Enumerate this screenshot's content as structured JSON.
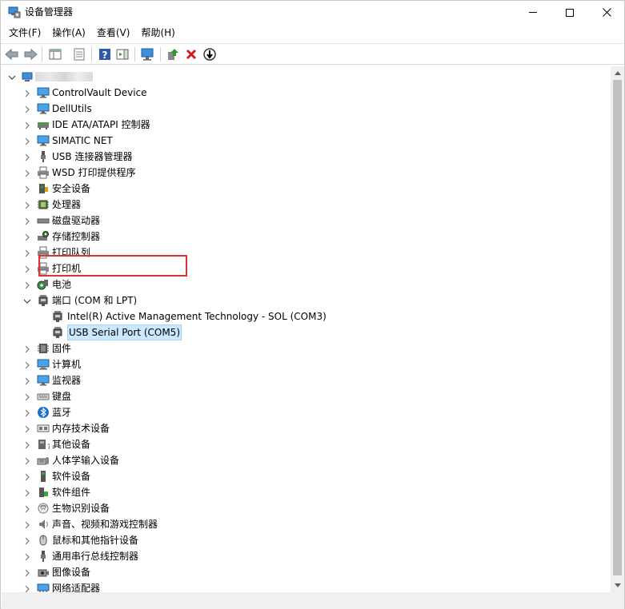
{
  "window": {
    "title": "设备管理器"
  },
  "menu": [
    "文件(F)",
    "操作(A)",
    "查看(V)",
    "帮助(H)"
  ],
  "toolbar": {
    "buttons": [
      "back-icon",
      "forward-icon",
      "show-hide-console-tree-icon",
      "properties-icon",
      "help-icon",
      "action-pane-icon",
      "scan-hardware-icon",
      "update-driver-icon",
      "uninstall-icon",
      "disable-icon"
    ]
  },
  "tree": {
    "root": {
      "label": "",
      "blurred": true
    },
    "items": [
      {
        "label": "ControlVault Device",
        "icon": "monitor-icon",
        "level": 1,
        "expanded": false
      },
      {
        "label": "DellUtils",
        "icon": "monitor-icon",
        "level": 1,
        "expanded": false
      },
      {
        "label": "IDE ATA/ATAPI 控制器",
        "icon": "ide-controller-icon",
        "level": 1,
        "expanded": false
      },
      {
        "label": "SIMATIC NET",
        "icon": "monitor-icon",
        "level": 1,
        "expanded": false
      },
      {
        "label": "USB 连接器管理器",
        "icon": "usb-icon",
        "level": 1,
        "expanded": false
      },
      {
        "label": "WSD 打印提供程序",
        "icon": "printer-icon",
        "level": 1,
        "expanded": false
      },
      {
        "label": "安全设备",
        "icon": "security-icon",
        "level": 1,
        "expanded": false
      },
      {
        "label": "处理器",
        "icon": "processor-icon",
        "level": 1,
        "expanded": false
      },
      {
        "label": "磁盘驱动器",
        "icon": "disk-drive-icon",
        "level": 1,
        "expanded": false
      },
      {
        "label": "存储控制器",
        "icon": "storage-controller-icon",
        "level": 1,
        "expanded": false
      },
      {
        "label": "打印队列",
        "icon": "printer-icon",
        "level": 1,
        "expanded": false
      },
      {
        "label": "打印机",
        "icon": "printer-icon",
        "level": 1,
        "expanded": false
      },
      {
        "label": "电池",
        "icon": "battery-icon",
        "level": 1,
        "expanded": false
      },
      {
        "label": "端口 (COM 和 LPT)",
        "icon": "port-icon",
        "level": 1,
        "expanded": true
      },
      {
        "label": "Intel(R) Active Management Technology - SOL (COM3)",
        "icon": "port-icon",
        "level": 2
      },
      {
        "label": "USB Serial Port (COM5)",
        "icon": "port-icon",
        "level": 2,
        "selected": true
      },
      {
        "label": "固件",
        "icon": "firmware-icon",
        "level": 1,
        "expanded": false
      },
      {
        "label": "计算机",
        "icon": "computer-icon",
        "level": 1,
        "expanded": false
      },
      {
        "label": "监视器",
        "icon": "monitor-icon",
        "level": 1,
        "expanded": false
      },
      {
        "label": "键盘",
        "icon": "keyboard-icon",
        "level": 1,
        "expanded": false
      },
      {
        "label": "蓝牙",
        "icon": "bluetooth-icon",
        "level": 1,
        "expanded": false
      },
      {
        "label": "内存技术设备",
        "icon": "memory-icon",
        "level": 1,
        "expanded": false
      },
      {
        "label": "其他设备",
        "icon": "other-device-icon",
        "level": 1,
        "expanded": false
      },
      {
        "label": "人体学输入设备",
        "icon": "hid-icon",
        "level": 1,
        "expanded": false
      },
      {
        "label": "软件设备",
        "icon": "software-device-icon",
        "level": 1,
        "expanded": false
      },
      {
        "label": "软件组件",
        "icon": "software-component-icon",
        "level": 1,
        "expanded": false
      },
      {
        "label": "生物识别设备",
        "icon": "fingerprint-icon",
        "level": 1,
        "expanded": false
      },
      {
        "label": "声音、视频和游戏控制器",
        "icon": "sound-icon",
        "level": 1,
        "expanded": false
      },
      {
        "label": "鼠标和其他指针设备",
        "icon": "mouse-icon",
        "level": 1,
        "expanded": false
      },
      {
        "label": "通用串行总线控制器",
        "icon": "usb-icon",
        "level": 1,
        "expanded": false
      },
      {
        "label": "图像设备",
        "icon": "camera-icon",
        "level": 1,
        "expanded": false
      },
      {
        "label": "网络适配器",
        "icon": "network-adapter-icon",
        "level": 1,
        "expanded": false
      }
    ]
  },
  "colors": {
    "selection_bg": "#cce8ff",
    "highlight_border": "#e03030"
  }
}
